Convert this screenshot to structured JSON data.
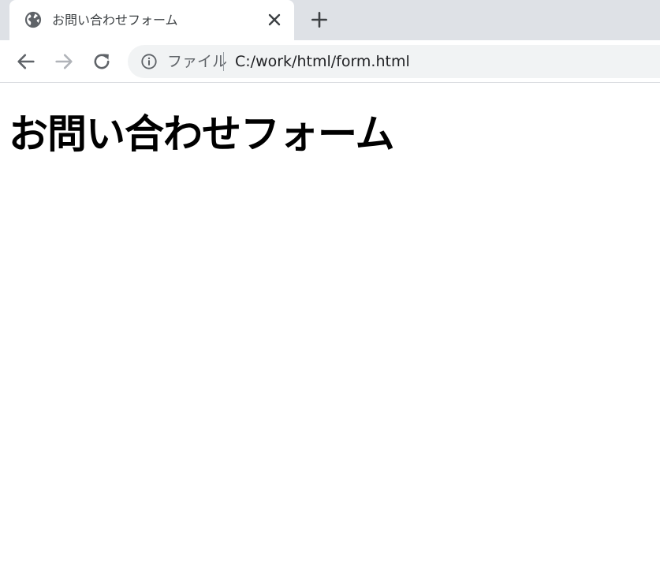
{
  "tab": {
    "title": "お問い合わせフォーム",
    "icon": "globe-icon",
    "close_icon": "close-icon"
  },
  "new_tab_icon": "plus-icon",
  "toolbar": {
    "back_icon": "arrow-back-icon",
    "forward_icon": "arrow-forward-icon",
    "reload_icon": "reload-icon"
  },
  "omnibox": {
    "info_icon": "info-icon",
    "scheme_label": "ファイル",
    "url": "C:/work/html/form.html"
  },
  "page": {
    "heading": "お問い合わせフォーム"
  },
  "colors": {
    "tab_strip": "#dee1e6",
    "omnibox": "#f1f3f4",
    "icon_dark": "#5f6368",
    "icon_disabled": "#b0b3b8"
  }
}
